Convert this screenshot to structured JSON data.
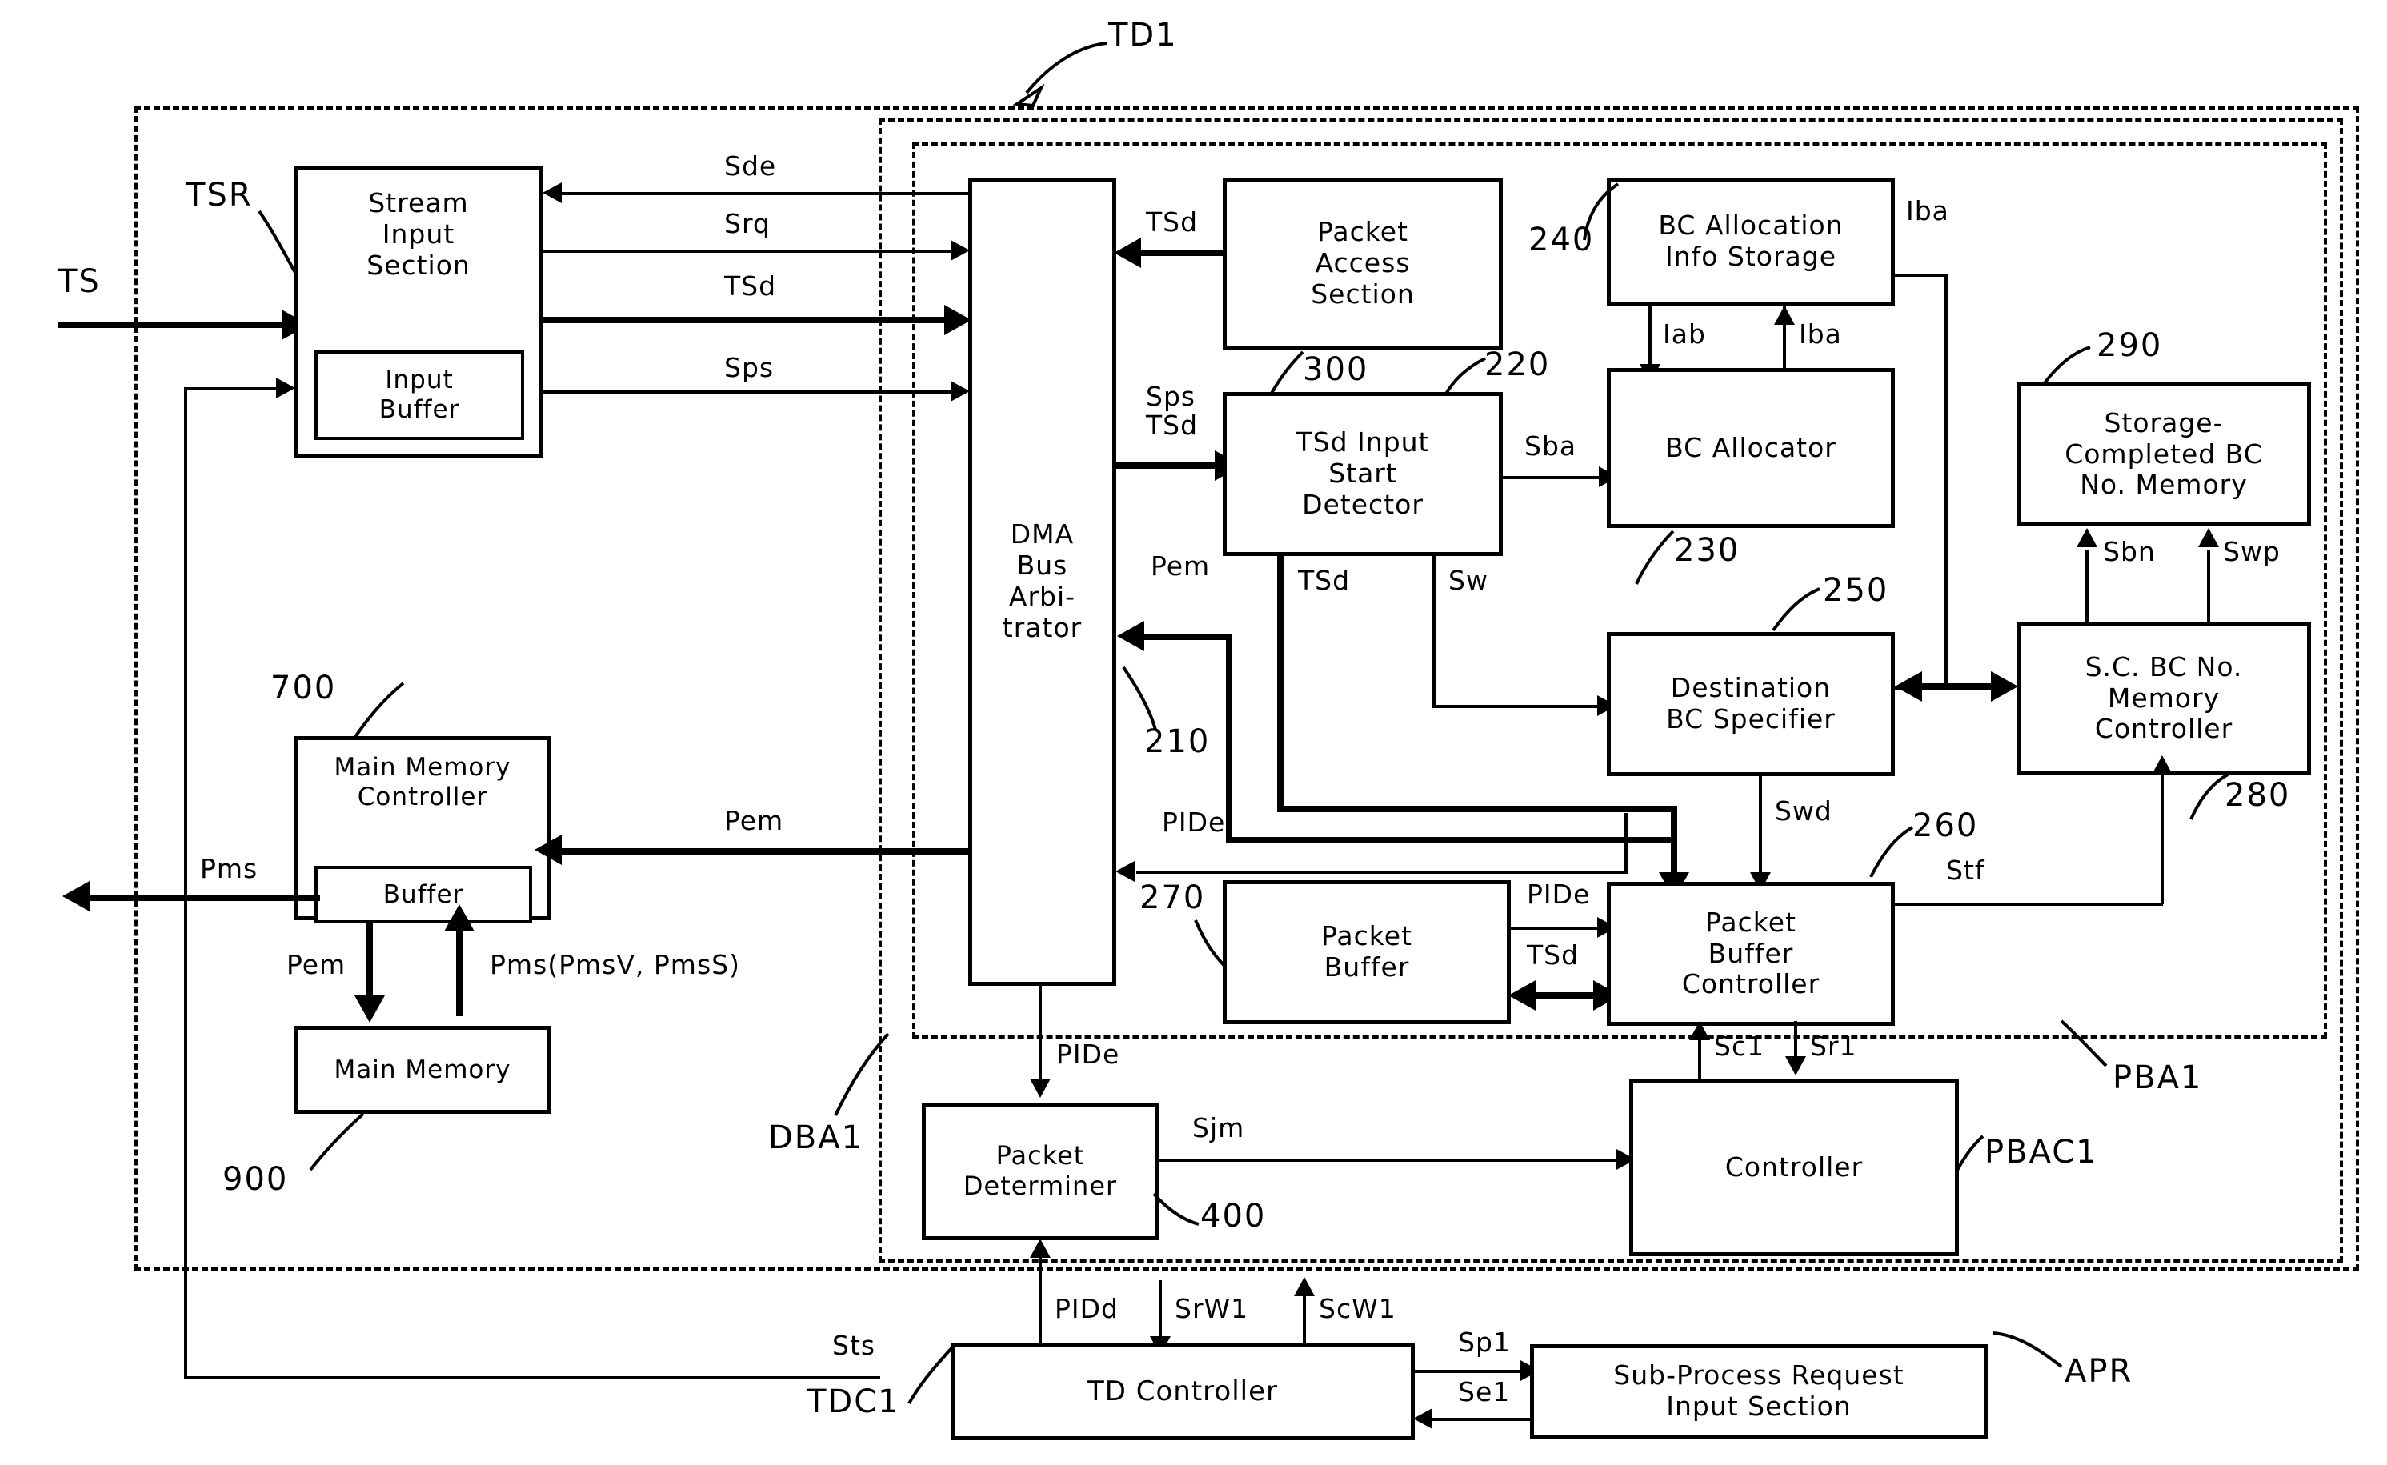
{
  "figure": {
    "title_label": "TD1",
    "type": "patent-block-diagram"
  },
  "blocks": [
    {
      "id": "stream_input_section",
      "label": "Stream\nInput\nSection"
    },
    {
      "id": "input_buffer",
      "label": "Input\nBuffer"
    },
    {
      "id": "dma_bus_arbitrator",
      "label": "DMA\nBus\nArbi-\ntrator"
    },
    {
      "id": "packet_access_section",
      "label": "Packet\nAccess\nSection"
    },
    {
      "id": "bc_allocation_info_storage",
      "label": "BC Allocation\nInfo Storage"
    },
    {
      "id": "tsd_input_start_detector",
      "label": "TSd Input\nStart\nDetector"
    },
    {
      "id": "bc_allocator",
      "label": "BC Allocator"
    },
    {
      "id": "storage_completed_bc_no_memory",
      "label": "Storage-\nCompleted BC\nNo. Memory"
    },
    {
      "id": "destination_bc_specifier",
      "label": "Destination\nBC Specifier"
    },
    {
      "id": "sc_bc_no_memory_controller",
      "label": "S.C. BC No.\nMemory\nController"
    },
    {
      "id": "main_memory_controller",
      "label": "Main Memory\nController"
    },
    {
      "id": "buffer",
      "label": "Buffer"
    },
    {
      "id": "main_memory",
      "label": "Main Memory"
    },
    {
      "id": "packet_buffer",
      "label": "Packet\nBuffer"
    },
    {
      "id": "packet_buffer_controller",
      "label": "Packet\nBuffer\nController"
    },
    {
      "id": "packet_determiner",
      "label": "Packet\nDeterminer"
    },
    {
      "id": "controller",
      "label": "Controller"
    },
    {
      "id": "td_controller",
      "label": "TD Controller"
    },
    {
      "id": "sub_process_request_input_section",
      "label": "Sub-Process Request\nInput Section"
    }
  ],
  "reference_numbers": {
    "packet_access_section": "300",
    "tsd_input_start_detector": "220",
    "bc_allocation_info_storage": "240",
    "bc_allocator": "230",
    "destination_bc_specifier": "250",
    "storage_completed_bc_no_memory": "290",
    "sc_bc_no_memory_controller": "280",
    "packet_buffer_controller": "260",
    "packet_buffer": "270",
    "dma_bus_arbitrator": "210",
    "main_memory_controller": "700",
    "main_memory": "900",
    "packet_determiner": "400"
  },
  "group_labels": {
    "td1": "TD1",
    "tsr": "TSR",
    "dba1": "DBA1",
    "pba1": "PBA1",
    "pbac1": "PBAC1",
    "tdc1": "TDC1",
    "apr": "APR"
  },
  "signals": {
    "ts": "TS",
    "sde": "Sde",
    "srq": "Srq",
    "tsd": "TSd",
    "sps": "Sps",
    "sps_tsd": "Sps\nTSd",
    "tsd_pas": "TSd",
    "iba_top": "Iba",
    "iab": "Iab",
    "iba_mid": "Iba",
    "sba": "Sba",
    "sbn": "Sbn",
    "swp": "Swp",
    "tsd_det": "TSd",
    "sw": "Sw",
    "pem_arb": "Pem",
    "pem_mmc": "Pem",
    "pem_mem": "Pem",
    "pms": "Pms",
    "pms_full": "Pms(PmsV, PmsS)",
    "pide_arb": "PIDe",
    "pide_pb": "PIDe",
    "tsd_pb": "TSd",
    "swd": "Swd",
    "stf": "Stf",
    "pide_det": "PIDe",
    "sjm": "Sjm",
    "sc1": "Sc1",
    "sr1": "Sr1",
    "pidd": "PIDd",
    "srw1": "SrW1",
    "scw1": "ScW1",
    "sp1": "Sp1",
    "se1": "Se1",
    "sts": "Sts"
  },
  "colors": {
    "stroke": "#000000",
    "background": "#ffffff"
  }
}
